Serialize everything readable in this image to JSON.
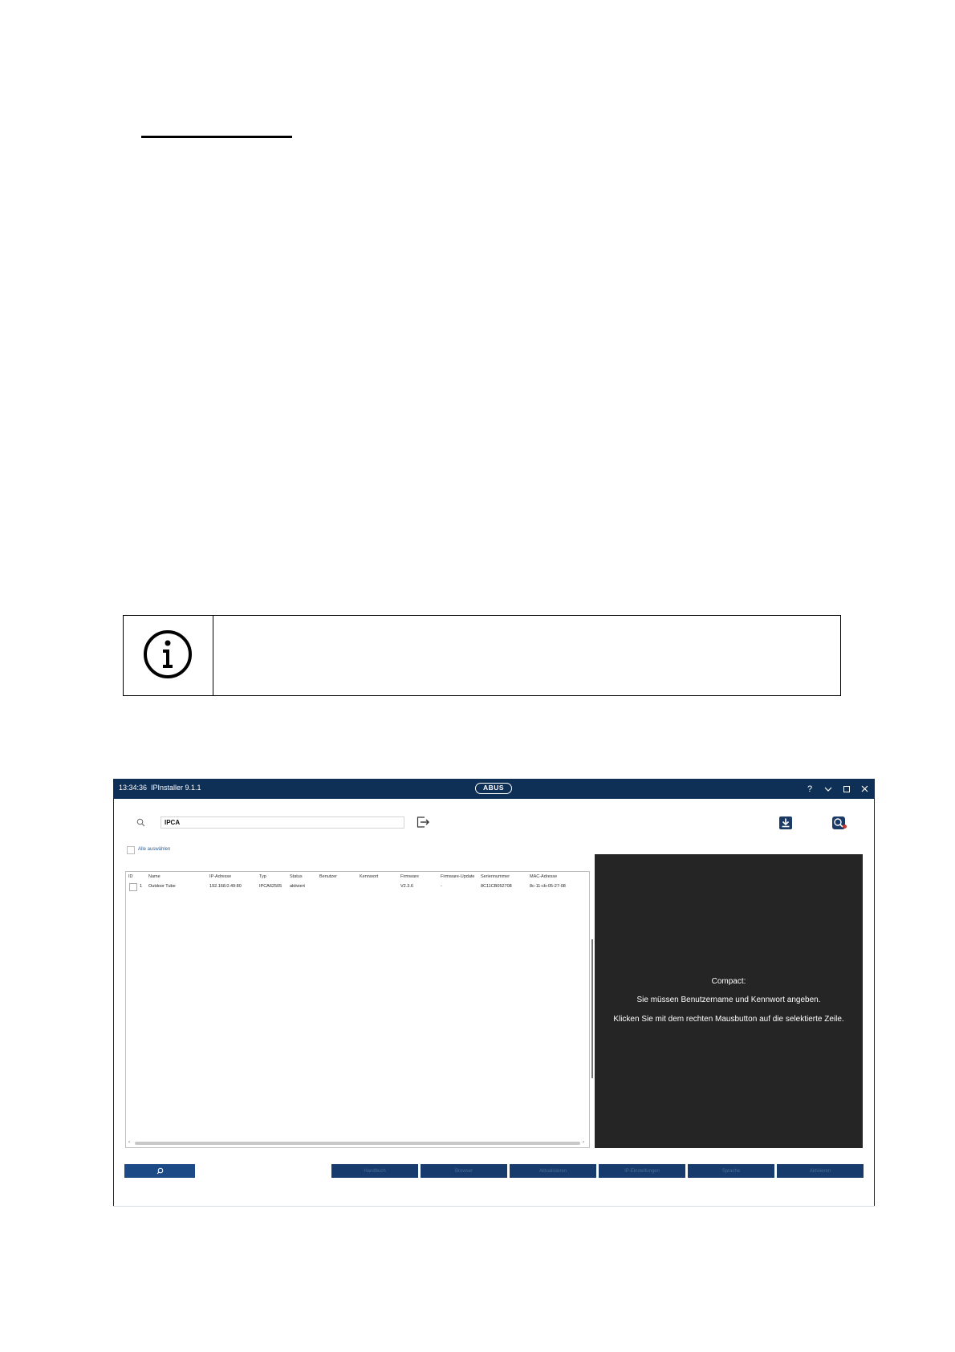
{
  "document": {
    "info_icon": "info-circle-icon"
  },
  "window": {
    "time": "13:34:36",
    "title": "IPInstaller 9.1.1",
    "logo": "ABUS",
    "help_icon": "?",
    "minimize_icon": "chevron-down-icon",
    "maximize_icon": "square-icon",
    "close_icon": "close-icon",
    "colors": {
      "titlebar": "#0e2f56",
      "button": "#173b6c",
      "panel": "#252525"
    }
  },
  "search": {
    "value": "IPCA",
    "placeholder": ""
  },
  "select_all_label": "Alle auswählen",
  "table": {
    "headers": [
      "ID",
      "Name",
      "IP-Adresse",
      "Typ",
      "Status",
      "Benutzer",
      "Kennwort",
      "Firmware",
      "Firmware-Update",
      "Seriennummer",
      "MAC-Adresse"
    ],
    "rows": [
      {
        "id": "1",
        "name": "Outdoor Tube",
        "ip": "192.168.0.49:80",
        "type": "IPCA62505",
        "status": "aktiviert",
        "user": "",
        "password": "",
        "firmware": "V2.3.6",
        "firmware_update": "-",
        "serial": "8C11CB052708",
        "mac": "8c-11-cb-05-27-08"
      }
    ]
  },
  "info_panel": {
    "title": "Compact:",
    "line1": "Sie müssen Benutzername und Kennwort angeben.",
    "line2": "Klicken Sie mit dem rechten Mausbutton auf die selektierte Zeile."
  },
  "toolbar": {
    "search_icon": "search-icon",
    "buttons": [
      "Handbuch",
      "Browser",
      "Aktualisieren",
      "IP-Einstellungen",
      "Sprache",
      "Aktivieren"
    ]
  }
}
